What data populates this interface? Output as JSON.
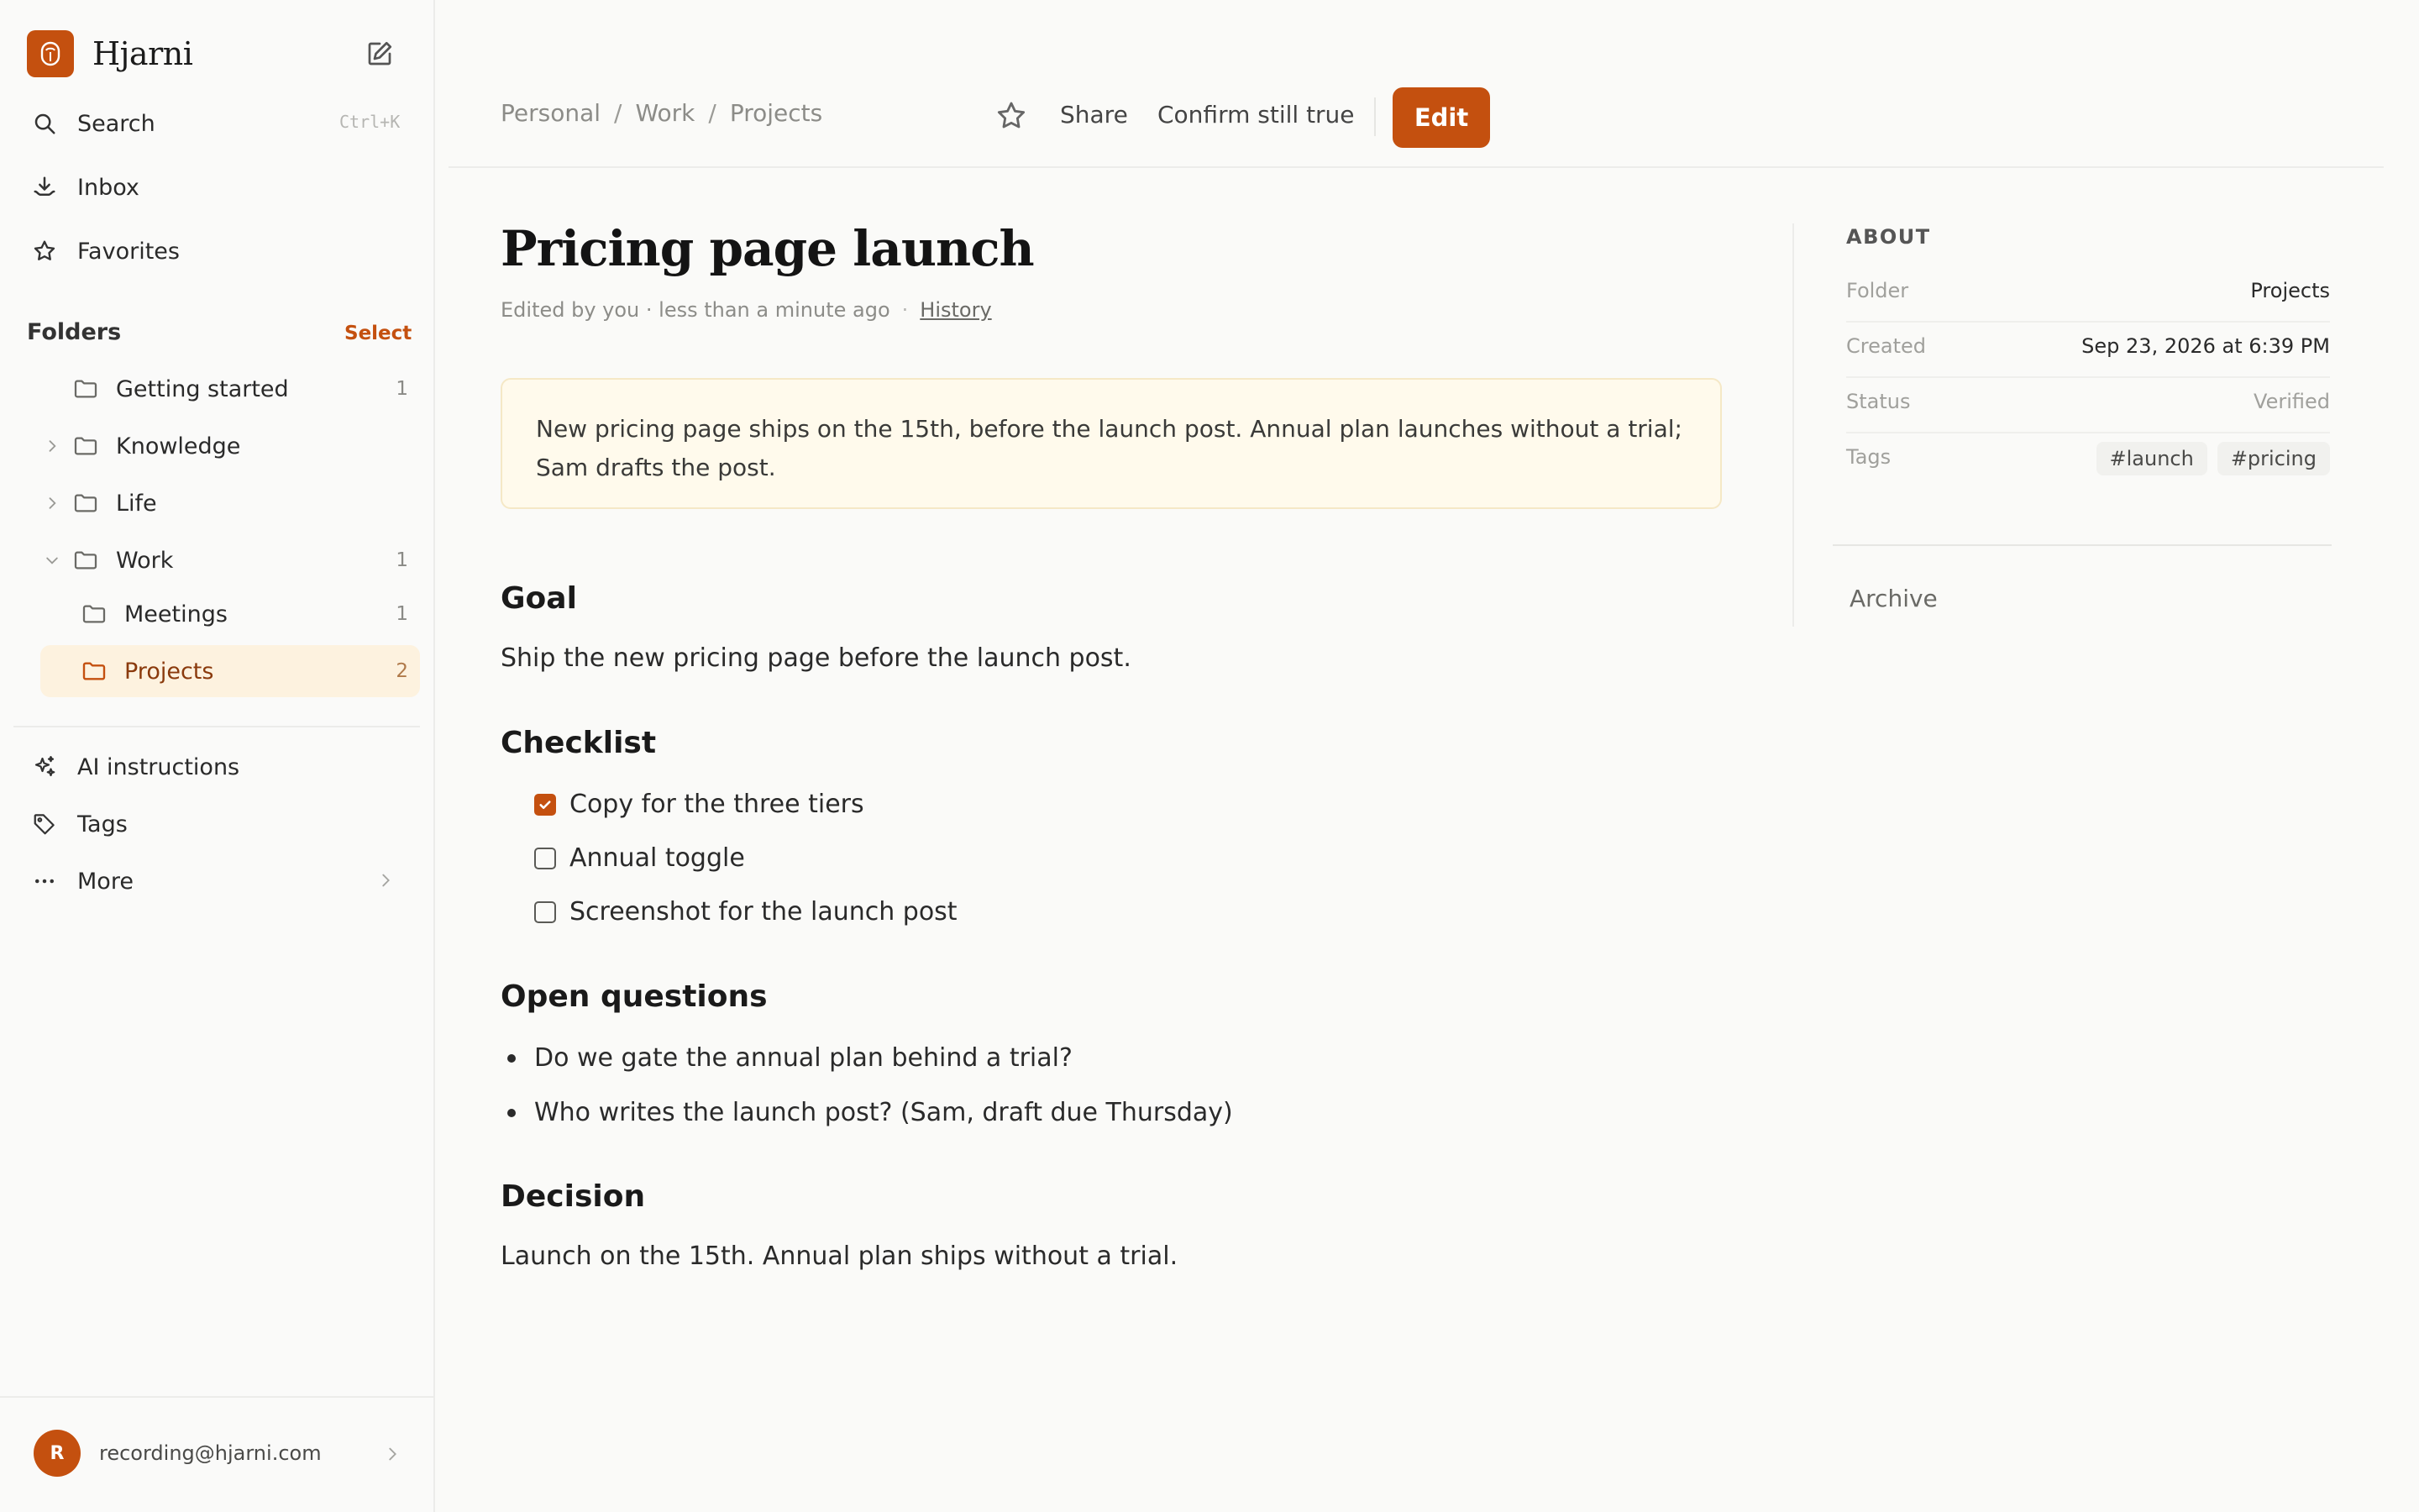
{
  "app": {
    "name": "Hjarni"
  },
  "sidebar": {
    "search": {
      "label": "Search",
      "shortcut": "Ctrl+K"
    },
    "inbox": {
      "label": "Inbox"
    },
    "favorites": {
      "label": "Favorites"
    },
    "folders_heading": "Folders",
    "select_label": "Select",
    "folders": [
      {
        "label": "Getting started",
        "count": "1"
      },
      {
        "label": "Knowledge",
        "count": ""
      },
      {
        "label": "Life",
        "count": ""
      },
      {
        "label": "Work",
        "count": "1"
      },
      {
        "label": "Meetings",
        "count": "1"
      },
      {
        "label": "Projects",
        "count": "2"
      }
    ],
    "ai_instructions": {
      "label": "AI instructions"
    },
    "tags": {
      "label": "Tags"
    },
    "more": {
      "label": "More"
    },
    "account": {
      "initial": "R",
      "email": "recording@hjarni.com"
    }
  },
  "header": {
    "breadcrumb": [
      "Personal",
      "Work",
      "Projects"
    ],
    "breadcrumb_separator": "/",
    "share_label": "Share",
    "confirm_label": "Confirm still true",
    "edit_label": "Edit"
  },
  "note": {
    "title": "Pricing page launch",
    "edited": "Edited by you · less than a minute ago",
    "meta_dot": "·",
    "history_label": "History",
    "summary": "New pricing page ships on the 15th, before the launch post. Annual plan launches without a trial; Sam drafts the post.",
    "goal_heading": "Goal",
    "goal_text": "Ship the new pricing page before the launch post.",
    "checklist_heading": "Checklist",
    "checklist": [
      {
        "label": "Copy for the three tiers",
        "checked": true
      },
      {
        "label": "Annual toggle",
        "checked": false
      },
      {
        "label": "Screenshot for the launch post",
        "checked": false
      }
    ],
    "open_questions_heading": "Open questions",
    "open_questions": [
      "Do we gate the annual plan behind a trial?",
      "Who writes the launch post? (Sam, draft due Thursday)"
    ],
    "decision_heading": "Decision",
    "decision_text": "Launch on the 15th. Annual plan ships without a trial."
  },
  "about": {
    "heading": "ABOUT",
    "folder_label": "Folder",
    "folder_value": "Projects",
    "created_label": "Created",
    "created_value": "Sep 23, 2026 at 6:39 PM",
    "status_label": "Status",
    "status_value": "Verified",
    "tags_label": "Tags",
    "tags": [
      "#launch",
      "#pricing"
    ],
    "archive_label": "Archive"
  },
  "colors": {
    "accent": "#c4500f",
    "active_bg": "#fdf2df",
    "callout_bg": "#fffaec"
  }
}
